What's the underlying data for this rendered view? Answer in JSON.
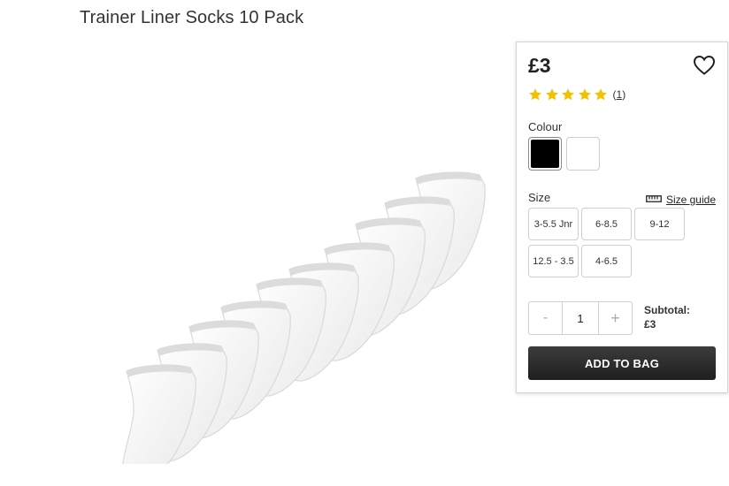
{
  "product": {
    "title": "Trainer Liner Socks 10 Pack",
    "image_alt": "White trainer liner socks"
  },
  "buy_box": {
    "price": "£3",
    "wishlist_icon": "heart-icon",
    "rating": {
      "stars": 5,
      "max": 5,
      "count_open": "(",
      "count": "1",
      "count_close": ")"
    },
    "colour_label": "Colour",
    "colours": [
      "Black",
      "White"
    ],
    "size_label": "Size",
    "size_guide_label": "Size guide",
    "sizes": [
      "3-5.5 Jnr",
      "6-8.5",
      "9-12",
      "12.5 - 3.5",
      "4-6.5"
    ],
    "quantity": {
      "minus": "-",
      "value": "1",
      "plus": "+"
    },
    "subtotal_label": "Subtotal:",
    "subtotal_value": "£3",
    "add_to_bag_label": "ADD TO BAG"
  },
  "colors": {
    "star": "#f2c200",
    "button": "#2b2b2b"
  }
}
